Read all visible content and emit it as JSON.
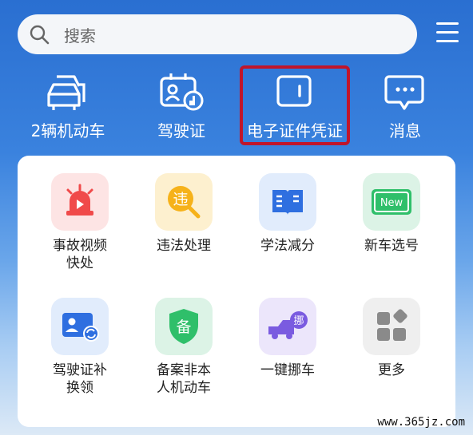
{
  "search": {
    "placeholder": "搜索",
    "icon": "search-icon"
  },
  "menu": {
    "icon": "hamburger-menu-icon"
  },
  "top_shortcuts": [
    {
      "label": "2辆机动车",
      "icon": "car-icon"
    },
    {
      "label": "驾驶证",
      "icon": "driver-license-icon"
    },
    {
      "label": "电子证件凭证",
      "icon": "wallet-icon"
    },
    {
      "label": "消息",
      "icon": "message-icon"
    }
  ],
  "highlight_color": "#c0152b",
  "services": [
    {
      "label": "事故视频\n快处",
      "icon": "siren-video-icon"
    },
    {
      "label": "违法处理",
      "icon": "violation-search-icon",
      "glyph": "违"
    },
    {
      "label": "学法减分",
      "icon": "book-icon"
    },
    {
      "label": "新车选号",
      "icon": "new-plate-icon",
      "glyph": "New"
    },
    {
      "label": "驾驶证补\n换领",
      "icon": "license-renew-icon"
    },
    {
      "label": "备案非本\n人机动车",
      "icon": "shield-record-icon",
      "glyph": "备"
    },
    {
      "label": "一键挪车",
      "icon": "truck-move-icon",
      "glyph": "挪"
    },
    {
      "label": "更多",
      "icon": "more-grid-icon"
    }
  ],
  "watermark": "www.365jz.com"
}
